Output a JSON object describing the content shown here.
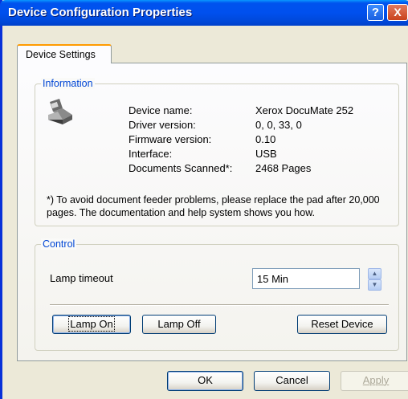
{
  "window": {
    "title": "Device Configuration Properties",
    "help_glyph": "?",
    "close_glyph": "X"
  },
  "tabs": [
    {
      "label": "Device Settings"
    }
  ],
  "information": {
    "legend": "Information",
    "icon": "scanner-icon",
    "fields": [
      {
        "label": "Device name:",
        "value": "Xerox DocuMate 252"
      },
      {
        "label": "Driver version:",
        "value": "0, 0, 33, 0"
      },
      {
        "label": "Firmware version:",
        "value": "0.10"
      },
      {
        "label": "Interface:",
        "value": "USB"
      },
      {
        "label": "Documents Scanned*:",
        "value": "2468 Pages"
      }
    ],
    "note": "*)  To avoid document feeder problems, please replace the pad after 20,000 pages. The documentation and help system shows you how."
  },
  "control": {
    "legend": "Control",
    "lamp_timeout_label": "Lamp timeout",
    "lamp_timeout_value": "15 Min",
    "lamp_on_label": "Lamp On",
    "lamp_off_label": "Lamp Off",
    "reset_label": "Reset Device"
  },
  "footer": {
    "ok_label": "OK",
    "cancel_label": "Cancel",
    "apply_label": "Apply"
  },
  "colors": {
    "titlebar": "#0054e3",
    "legend_text": "#0046d5",
    "dialog_bg": "#ece9d8",
    "tab_highlight": "#ff9b00"
  }
}
